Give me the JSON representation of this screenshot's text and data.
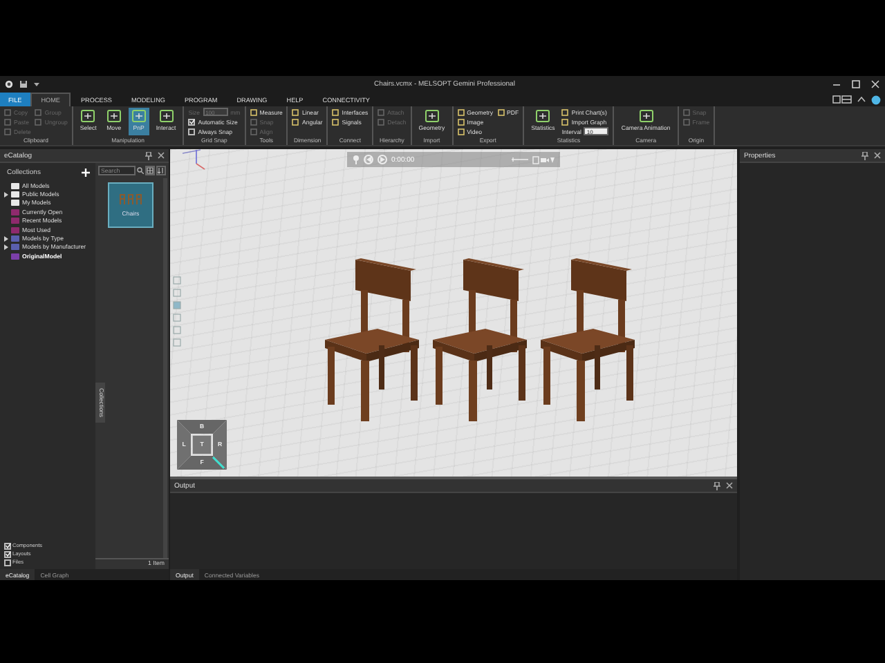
{
  "window": {
    "title": "Chairs.vcmx - MELSOPT Gemini Professional"
  },
  "tabs": [
    {
      "label": "FILE",
      "kind": "file",
      "selected": false
    },
    {
      "label": "HOME",
      "kind": "tab",
      "selected": true
    },
    {
      "label": "PROCESS",
      "kind": "tab",
      "selected": false
    },
    {
      "label": "MODELING",
      "kind": "tab",
      "selected": false
    },
    {
      "label": "PROGRAM",
      "kind": "tab",
      "selected": false
    },
    {
      "label": "DRAWING",
      "kind": "tab",
      "selected": false
    },
    {
      "label": "HELP",
      "kind": "tab",
      "selected": false
    },
    {
      "label": "CONNECTIVITY",
      "kind": "tab",
      "selected": false
    }
  ],
  "ribbon": [
    {
      "label": "Clipboard",
      "items": [
        {
          "kind": "small",
          "label": "Copy",
          "disabled": true
        },
        {
          "kind": "small",
          "label": "Paste",
          "disabled": true
        },
        {
          "kind": "small",
          "label": "Delete",
          "disabled": true
        },
        {
          "kind": "small",
          "label": "Group",
          "disabled": true
        },
        {
          "kind": "small",
          "label": "Ungroup",
          "disabled": true
        }
      ]
    },
    {
      "label": "Manipulation",
      "items": [
        {
          "kind": "large",
          "label": "Select",
          "disabled": false,
          "selected": false
        },
        {
          "kind": "large",
          "label": "Move",
          "disabled": false,
          "selected": false
        },
        {
          "kind": "large",
          "label": "PnP",
          "disabled": false,
          "selected": true
        },
        {
          "kind": "large",
          "label": "Interact",
          "disabled": false,
          "selected": false
        }
      ]
    },
    {
      "label": "Grid Snap",
      "items": [
        {
          "kind": "field",
          "label": "Size",
          "value": "100",
          "unit": "mm",
          "disabled": true
        },
        {
          "kind": "check",
          "label": "Automatic Size",
          "checked": true
        },
        {
          "kind": "check",
          "label": "Always Snap",
          "checked": false
        }
      ]
    },
    {
      "label": "Tools",
      "items": [
        {
          "kind": "small",
          "label": "Measure",
          "disabled": false
        },
        {
          "kind": "small",
          "label": "Snap",
          "disabled": true
        },
        {
          "kind": "small",
          "label": "Align",
          "disabled": true
        }
      ]
    },
    {
      "label": "Dimension",
      "items": [
        {
          "kind": "small",
          "label": "Linear",
          "disabled": false
        },
        {
          "kind": "small",
          "label": "Angular",
          "disabled": false
        }
      ]
    },
    {
      "label": "Connect",
      "items": [
        {
          "kind": "small",
          "label": "Interfaces",
          "disabled": false
        },
        {
          "kind": "small",
          "label": "Signals",
          "disabled": false
        }
      ]
    },
    {
      "label": "Hierarchy",
      "items": [
        {
          "kind": "small",
          "label": "Attach",
          "disabled": true
        },
        {
          "kind": "small",
          "label": "Detach",
          "disabled": true
        }
      ]
    },
    {
      "label": "Import",
      "items": [
        {
          "kind": "large",
          "label": "Geometry",
          "disabled": false
        }
      ]
    },
    {
      "label": "Export",
      "items": [
        {
          "kind": "small",
          "label": "Geometry",
          "disabled": false
        },
        {
          "kind": "small",
          "label": "Image",
          "disabled": false
        },
        {
          "kind": "small",
          "label": "Video",
          "disabled": false
        },
        {
          "kind": "small",
          "label": "PDF",
          "disabled": false
        }
      ]
    },
    {
      "label": "Statistics",
      "items": [
        {
          "kind": "large",
          "label": "Statistics",
          "disabled": false
        },
        {
          "kind": "small",
          "label": "Print Chart(s)",
          "disabled": false
        },
        {
          "kind": "small",
          "label": "Import Graph",
          "disabled": false
        },
        {
          "kind": "field",
          "label": "Interval",
          "value": "10",
          "disabled": false
        }
      ]
    },
    {
      "label": "Camera",
      "items": [
        {
          "kind": "large",
          "label": "Camera Animation",
          "disabled": false
        }
      ]
    },
    {
      "label": "Origin",
      "items": [
        {
          "kind": "small",
          "label": "Snap",
          "disabled": true
        },
        {
          "kind": "small",
          "label": "Frame",
          "disabled": true
        }
      ]
    }
  ],
  "catalog": {
    "title": "eCatalog",
    "section": "Collections",
    "search": {
      "placeholder": "Search"
    },
    "collections": [
      {
        "label": "All Models",
        "kind": "stack",
        "expandable": false,
        "emphasized": false
      },
      {
        "label": "Public Models",
        "kind": "folder",
        "expandable": true,
        "emphasized": false
      },
      {
        "label": "My Models",
        "kind": "folder",
        "expandable": false,
        "emphasized": false
      },
      {
        "label": "Currently Open",
        "kind": "smart",
        "expandable": false,
        "emphasized": false
      },
      {
        "label": "Recent Models",
        "kind": "smart",
        "expandable": false,
        "emphasized": false
      },
      {
        "label": "Most Used",
        "kind": "smart",
        "expandable": false,
        "emphasized": false
      },
      {
        "label": "Models by Type",
        "kind": "group",
        "expandable": true,
        "emphasized": false
      },
      {
        "label": "Models by Manufacturer",
        "kind": "group",
        "expandable": true,
        "emphasized": false
      },
      {
        "label": "OriginalModel",
        "kind": "model",
        "expandable": false,
        "emphasized": true
      }
    ],
    "thumbnails": [
      {
        "label": "Chairs",
        "selected": true
      }
    ],
    "side_tab": "Collections",
    "filters": [
      {
        "label": "Components",
        "checked": true
      },
      {
        "label": "Layouts",
        "checked": true
      },
      {
        "label": "Files",
        "checked": false
      }
    ],
    "item_count": "1 Item"
  },
  "left_tabs": [
    {
      "label": "eCatalog",
      "selected": true
    },
    {
      "label": "Cell Graph",
      "selected": false
    }
  ],
  "viewport": {
    "time": "0:00:00",
    "nav_cube": {
      "top": "B",
      "left": "L",
      "center": "T",
      "right": "R",
      "bottom": "F"
    }
  },
  "output": {
    "title": "Output"
  },
  "bottom_tabs": [
    {
      "label": "Output",
      "selected": true
    },
    {
      "label": "Connected Variables",
      "selected": false
    }
  ],
  "properties": {
    "title": "Properties"
  }
}
